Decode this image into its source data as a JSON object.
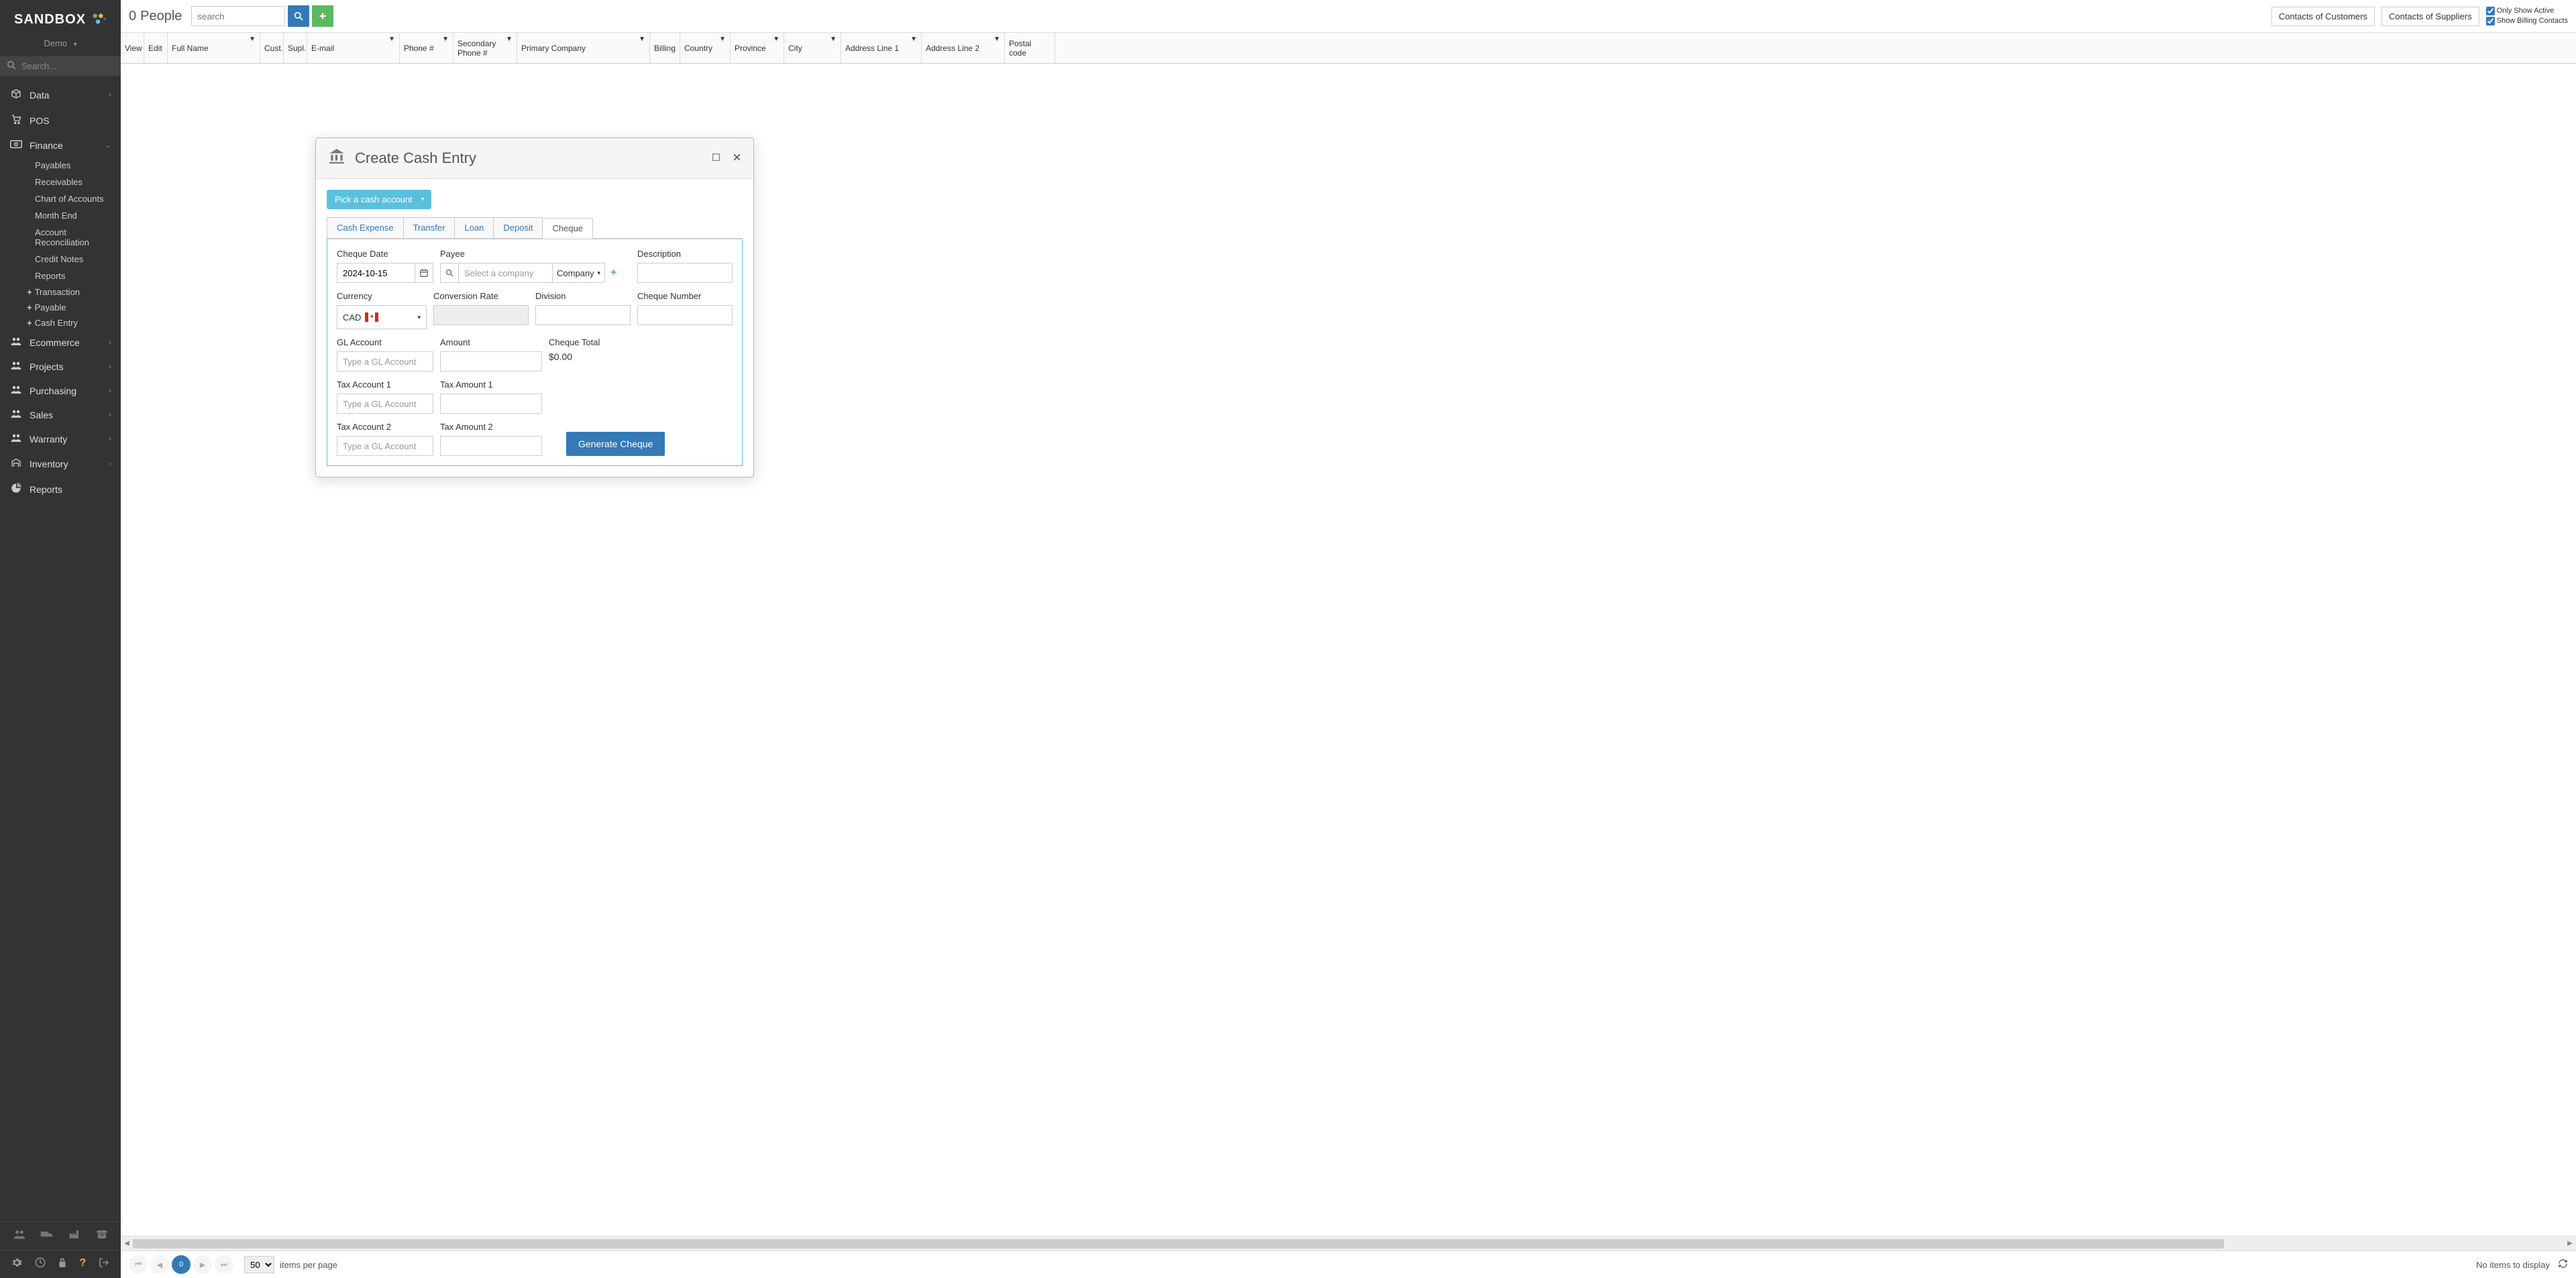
{
  "brand": "SANDBOX",
  "tenant": "Demo",
  "sideSearchPlaceholder": "Search...",
  "nav": {
    "data": "Data",
    "pos": "POS",
    "finance": "Finance",
    "financeSubs": {
      "payables": "Payables",
      "receivables": "Receivables",
      "coa": "Chart of Accounts",
      "monthEnd": "Month End",
      "reconciliation": "Account Reconciliation",
      "creditNotes": "Credit Notes",
      "reports": "Reports",
      "transaction": "Transaction",
      "payable": "Payable",
      "cashEntry": "Cash Entry"
    },
    "ecommerce": "Ecommerce",
    "projects": "Projects",
    "purchasing": "Purchasing",
    "sales": "Sales",
    "warranty": "Warranty",
    "inventory": "Inventory",
    "reports": "Reports"
  },
  "header": {
    "count": "0",
    "title": "People",
    "searchPlaceholder": "search",
    "contactsCustomers": "Contacts of Customers",
    "contactsSuppliers": "Contacts of Suppliers",
    "onlyActive": "Only Show Active",
    "showBilling": "Show Billing Contacts"
  },
  "columns": {
    "view": "View",
    "edit": "Edit",
    "fullName": "Full Name",
    "cust": "Cust.",
    "supl": "Supl.",
    "email": "E-mail",
    "phone": "Phone #",
    "phone2": "Secondary Phone #",
    "primaryCompany": "Primary Company",
    "billing": "Billing",
    "country": "Country",
    "province": "Province",
    "city": "City",
    "addr1": "Address Line 1",
    "addr2": "Address Line 2",
    "postal": "Postal code"
  },
  "pager": {
    "page": "0",
    "ipp": "50",
    "ippLabel": "items per page",
    "noItems": "No items to display"
  },
  "modal": {
    "title": "Create Cash Entry",
    "pickAccount": "Pick a cash account",
    "tabs": {
      "cashExpense": "Cash Expense",
      "transfer": "Transfer",
      "loan": "Loan",
      "deposit": "Deposit",
      "cheque": "Cheque"
    },
    "labels": {
      "chequeDate": "Cheque Date",
      "payee": "Payee",
      "description": "Description",
      "currency": "Currency",
      "conversionRate": "Conversion Rate",
      "division": "Division",
      "chequeNumber": "Cheque Number",
      "glAccount": "GL Account",
      "amount": "Amount",
      "chequeTotal": "Cheque Total",
      "taxAcct1": "Tax Account 1",
      "taxAmt1": "Tax Amount 1",
      "taxAcct2": "Tax Account 2",
      "taxAmt2": "Tax Amount 2"
    },
    "values": {
      "chequeDate": "2024-10-15",
      "payeePlaceholder": "Select a company",
      "payeeType": "Company",
      "currency": "CAD",
      "glPlaceholder": "Type a GL Account",
      "chequeTotal": "$0.00",
      "generateBtn": "Generate Cheque"
    }
  }
}
